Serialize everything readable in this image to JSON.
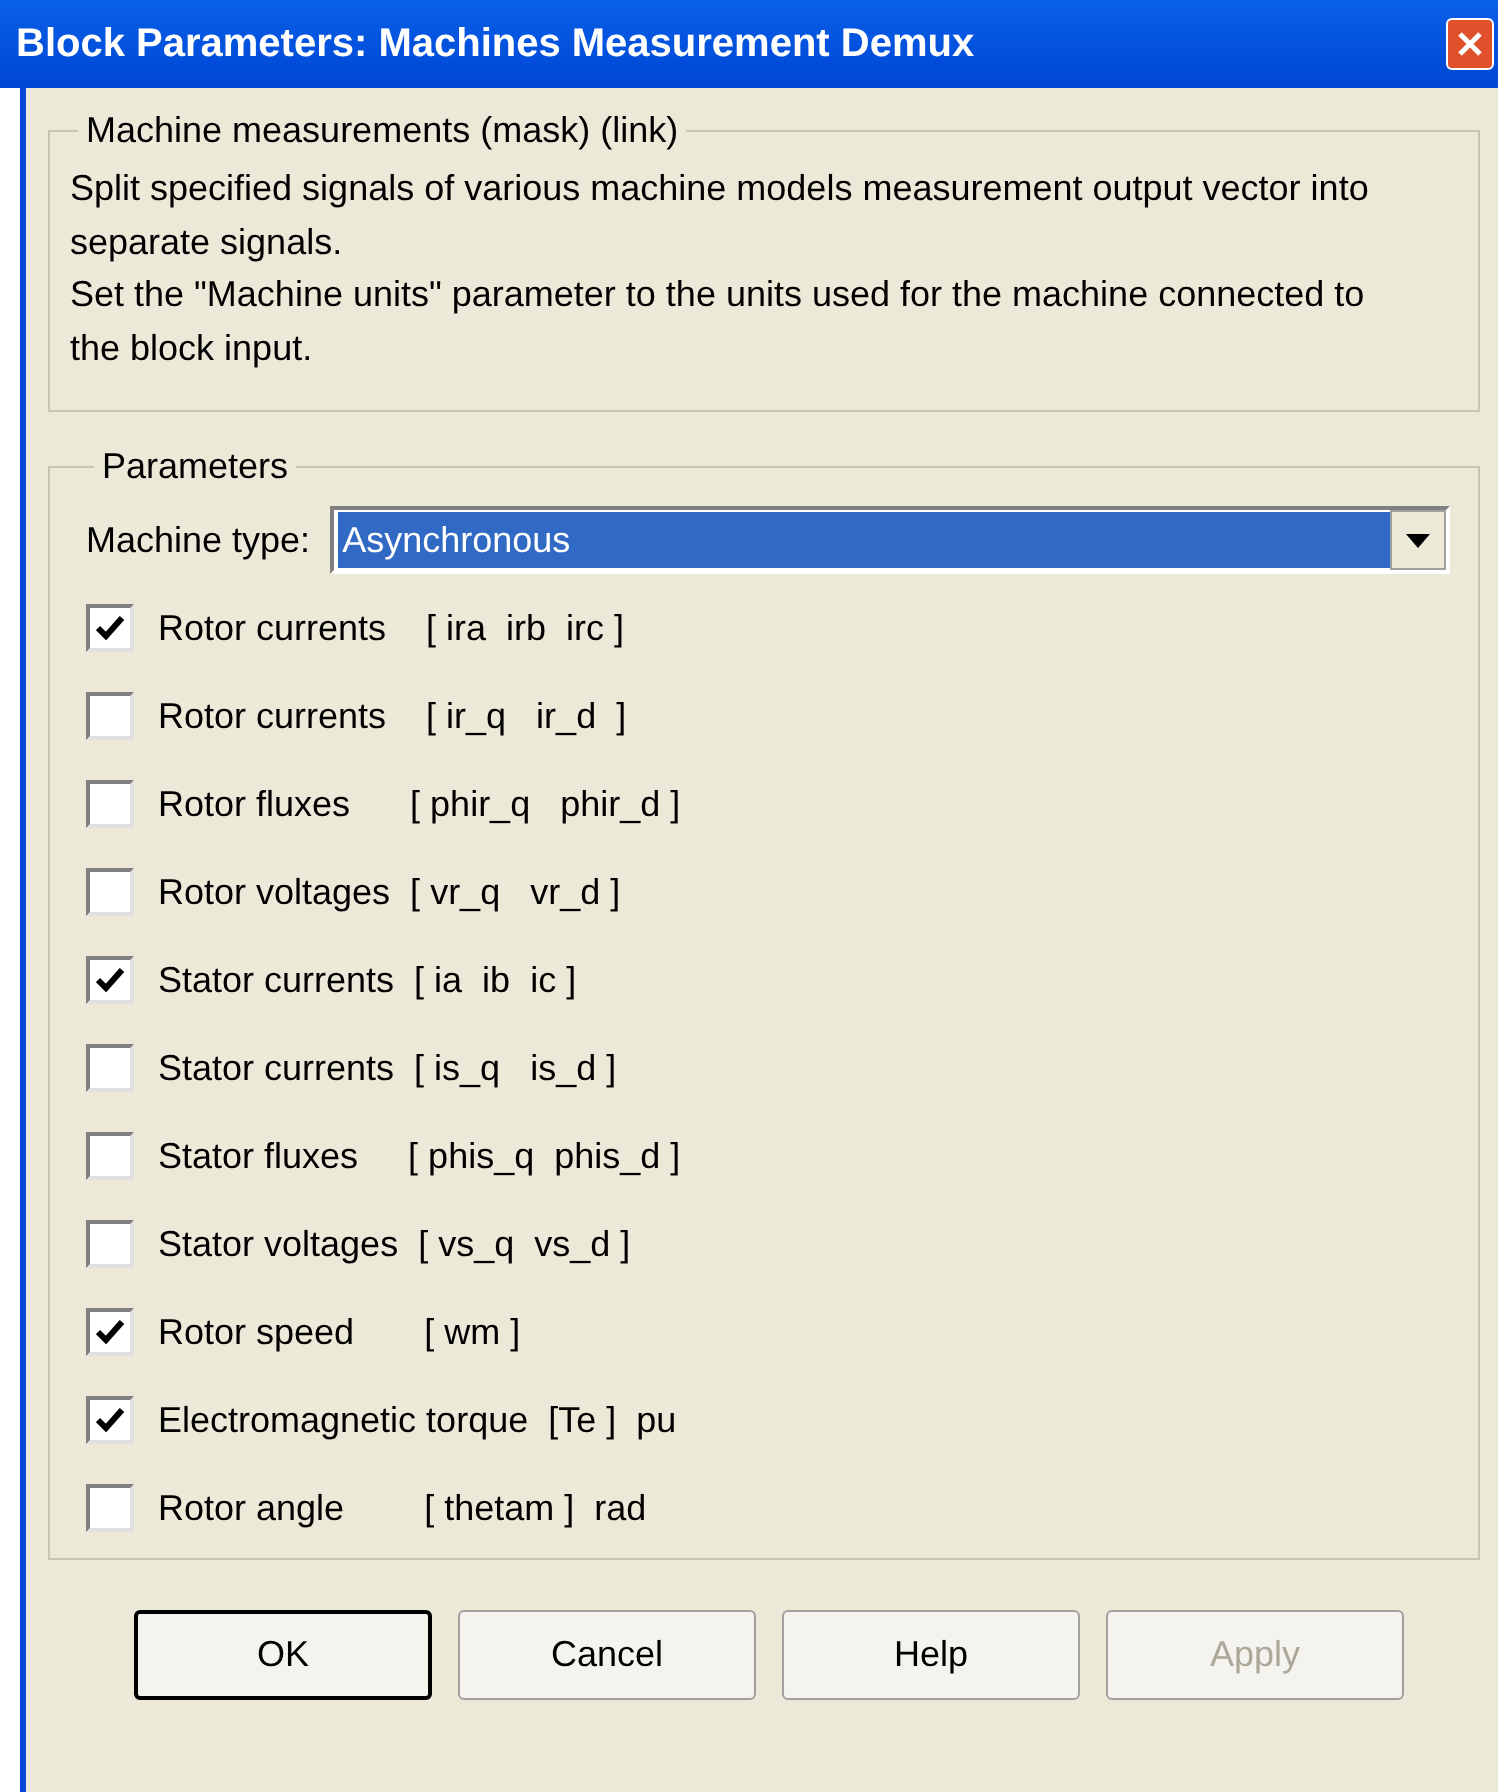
{
  "window": {
    "title": "Block Parameters: Machines Measurement Demux"
  },
  "description": {
    "legend": "Machine measurements (mask) (link)",
    "lines": [
      "Split specified signals of various machine models measurement output vector into separate signals.",
      "Set the \"Machine units\" parameter to the units used for the machine connected to the block input."
    ]
  },
  "parameters": {
    "legend": "Parameters",
    "machine_type": {
      "label": "Machine type:",
      "value": "Asynchronous"
    },
    "checkboxes": [
      {
        "label": "Rotor currents    [ ira  irb  irc ]",
        "checked": true
      },
      {
        "label": "Rotor currents    [ ir_q   ir_d  ]",
        "checked": false
      },
      {
        "label": "Rotor fluxes      [ phir_q   phir_d ]",
        "checked": false
      },
      {
        "label": "Rotor voltages  [ vr_q   vr_d ]",
        "checked": false
      },
      {
        "label": "Stator currents  [ ia  ib  ic ]",
        "checked": true
      },
      {
        "label": "Stator currents  [ is_q   is_d ]",
        "checked": false
      },
      {
        "label": "Stator fluxes     [ phis_q  phis_d ]",
        "checked": false
      },
      {
        "label": "Stator voltages  [ vs_q  vs_d ]",
        "checked": false
      },
      {
        "label": "Rotor speed       [ wm ]",
        "checked": true
      },
      {
        "label": "Electromagnetic torque  [Te ]  pu",
        "checked": true
      },
      {
        "label": "Rotor angle        [ thetam ]  rad",
        "checked": false
      }
    ]
  },
  "buttons": [
    {
      "label": "OK",
      "default": true,
      "disabled": false
    },
    {
      "label": "Cancel",
      "default": false,
      "disabled": false
    },
    {
      "label": "Help",
      "default": false,
      "disabled": false
    },
    {
      "label": "Apply",
      "default": false,
      "disabled": true
    }
  ]
}
